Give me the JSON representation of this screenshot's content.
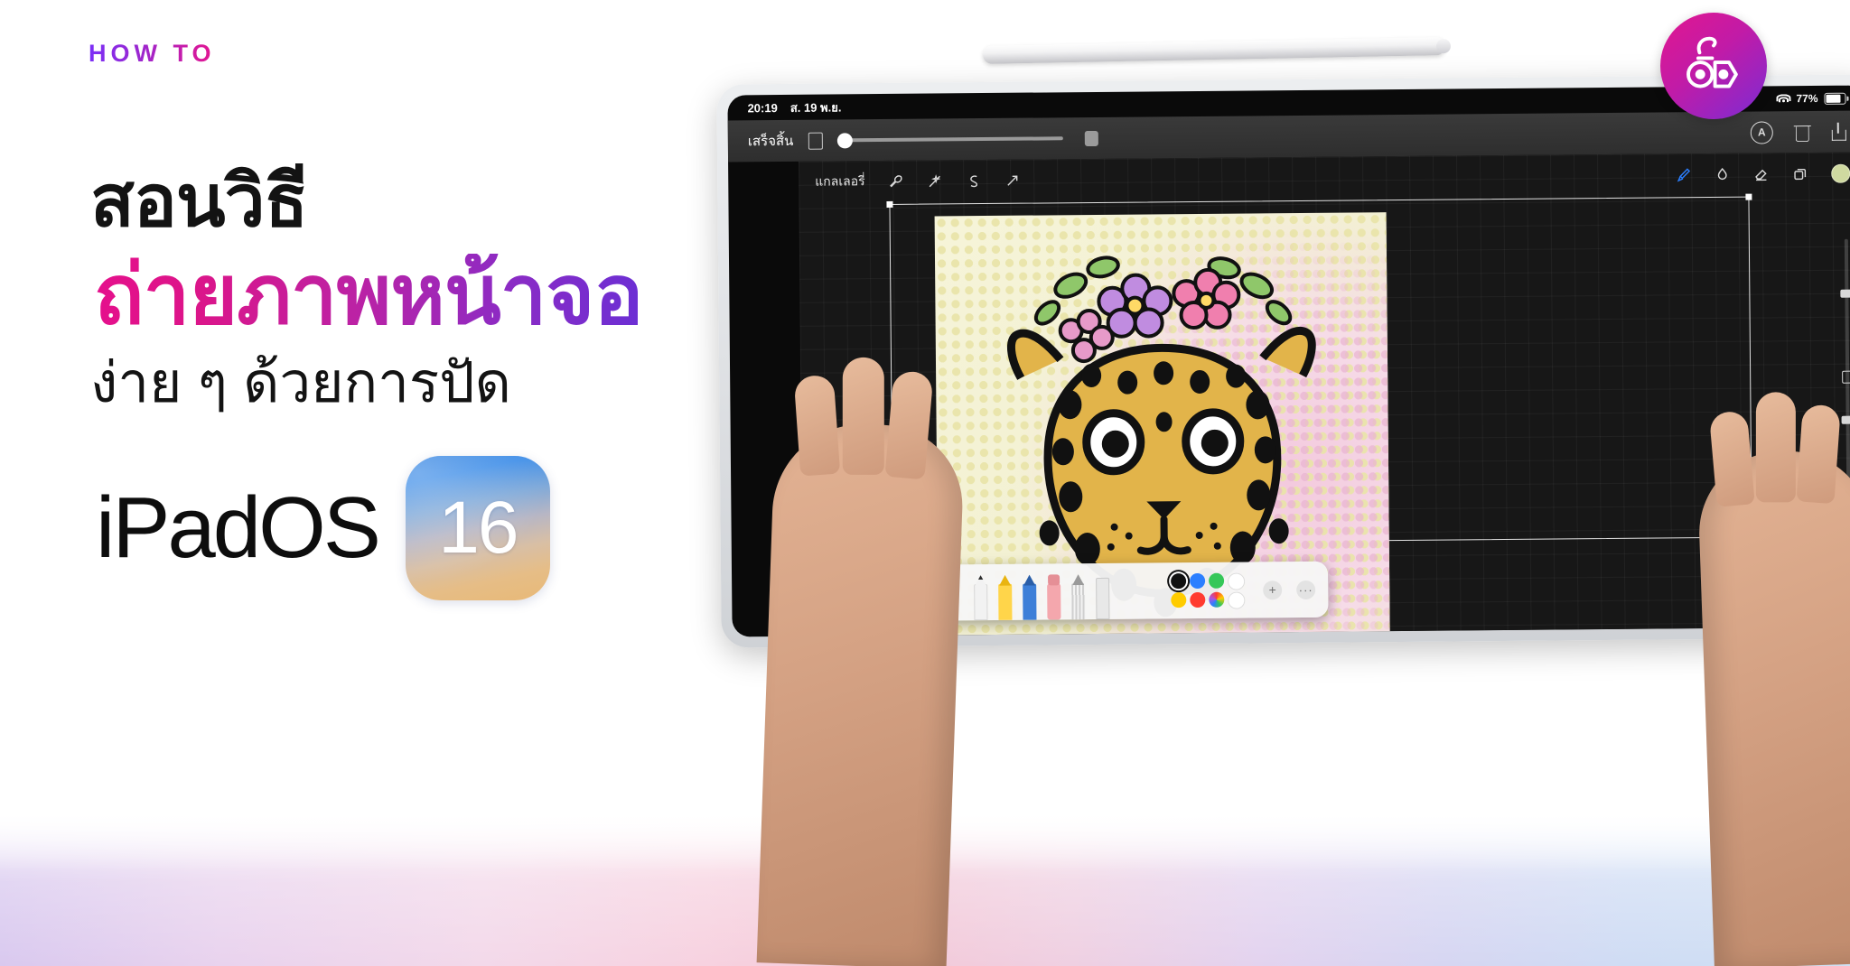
{
  "left": {
    "eyebrow": "HOW TO",
    "headline_1": "สอนวิธี",
    "headline_2": "ถ่ายภาพหน้าจอ",
    "headline_3": "ง่าย ๆ ด้วยการปัด",
    "os_word": "iPadOS",
    "os_version": "16",
    "colors": {
      "eyebrow_from": "#7b2ff7",
      "eyebrow_to": "#e6158f",
      "headline_from": "#e5108c",
      "headline_to": "#6b2fd4",
      "headline_black": "#131313",
      "badge_top": "#2d7fe0",
      "badge_bottom": "#e8b977"
    }
  },
  "device": {
    "status_bar": {
      "time": "20:19",
      "date": "ส. 19 พ.ย.",
      "battery_percent": "77%",
      "wifi_icon": "wifi-icon",
      "battery_icon": "battery-icon"
    },
    "screenshot_toolbar": {
      "done_label": "เสร็จสิ้น",
      "markup_icon": "rectangle-icon",
      "slider_value": 0,
      "end_icon": "square-icon",
      "annotate_icon": "circle-a-icon",
      "delete_icon": "trash-icon",
      "share_icon": "share-icon"
    },
    "procreate_toolbar": {
      "gallery_label": "แกลเลอรี่",
      "tools": [
        "wrench-icon",
        "magic-wand-icon",
        "selection-s-icon",
        "transform-arrow-icon"
      ],
      "right_tools": [
        "brush-icon",
        "smudge-icon",
        "eraser-icon",
        "layers-icon"
      ],
      "active_tool": "brush-icon",
      "color_swatch": "#cfd9a0"
    },
    "canvas_sliders": {
      "brush_size_icon": "size-slider",
      "opacity_icon": "opacity-slider",
      "modify_icon": "square-icon",
      "undo_icon": "undo-icon",
      "redo_icon": "redo-icon"
    },
    "markup_palette": {
      "undo_icon": "undo-arrow-icon",
      "redo_icon": "redo-arrow-icon",
      "tools": [
        {
          "name": "pen-tool",
          "color": "#f2f2f2",
          "tip": "#2c2c2c"
        },
        {
          "name": "highlighter-tool",
          "color": "#ffd54a",
          "tip": "#e9b411"
        },
        {
          "name": "pencil-tool",
          "color": "#3d7fd8",
          "tip": "#2a5ea8"
        },
        {
          "name": "eraser-tool",
          "color": "#f4a7ad",
          "tip": "#e58f96"
        },
        {
          "name": "lasso-tool",
          "color": "#dcdcdc",
          "tip": "#9a9a9a"
        },
        {
          "name": "ruler-tool",
          "color": "#e8e8e8",
          "tip": "#b9b9b9"
        }
      ],
      "swatches": [
        "#111111",
        "#2b7fff",
        "#35c759",
        "#ffffff",
        "#ffcc00",
        "#ff3b30",
        "conic",
        "#ffffff"
      ],
      "add_icon": "plus-icon",
      "more_icon": "ellipsis-icon"
    },
    "artwork": {
      "title": "leopard-with-flower-crown-illustration",
      "background_top": "#f6f4d9",
      "background_accent": "#f3c9dd",
      "fur_color": "#e2b44a",
      "spot_color": "#111111"
    }
  },
  "brand_logo": {
    "name": "site-logo",
    "gradient_from": "#e2178f",
    "gradient_to": "#7b2cd4"
  }
}
